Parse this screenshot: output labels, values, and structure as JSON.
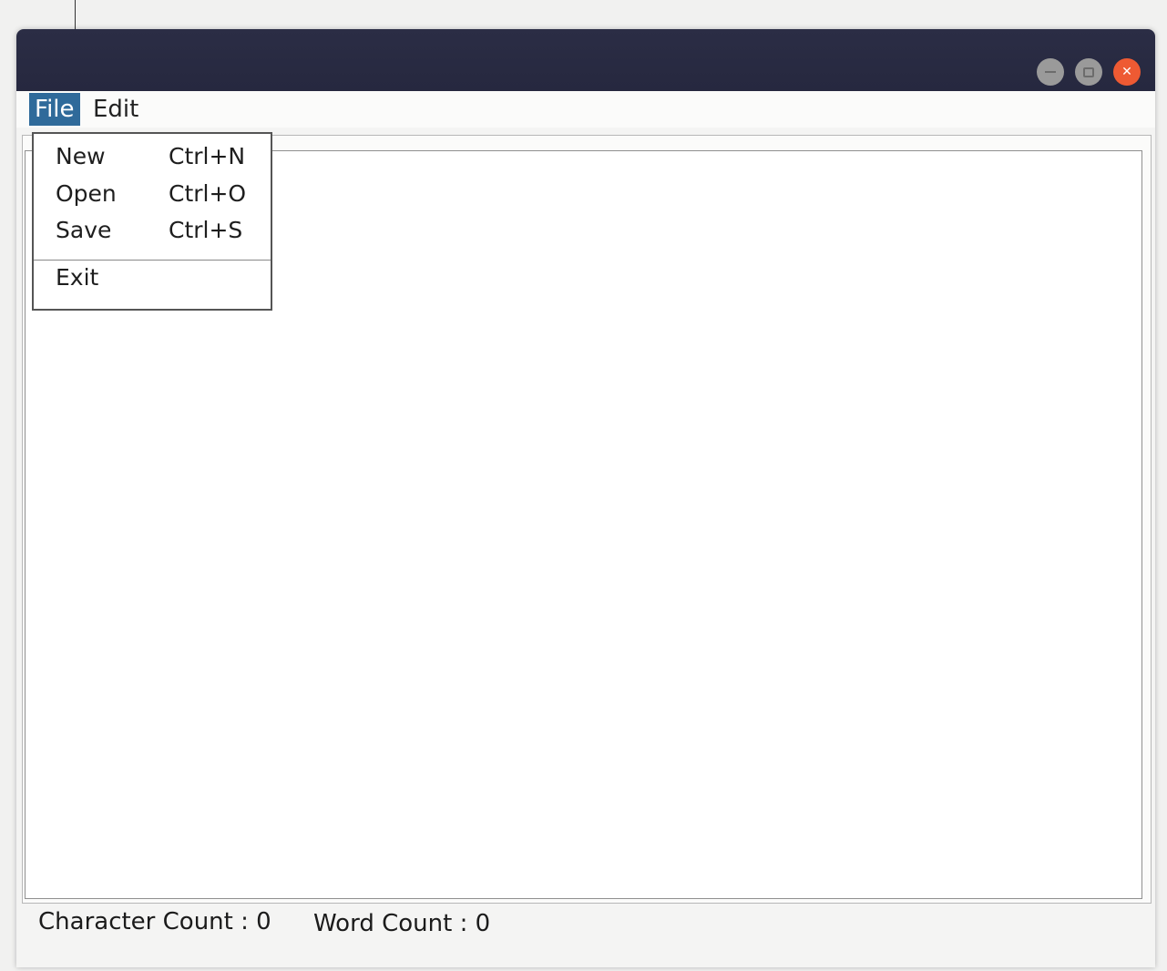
{
  "menubar": {
    "file_label": "File",
    "edit_label": "Edit"
  },
  "file_menu": {
    "items": [
      {
        "label": "New",
        "accelerator": "Ctrl+N"
      },
      {
        "label": "Open",
        "accelerator": "Ctrl+O"
      },
      {
        "label": "Save",
        "accelerator": "Ctrl+S"
      }
    ],
    "exit_label": "Exit"
  },
  "status": {
    "char_label": "Character Count :",
    "char_value": "0",
    "word_label": "Word Count :",
    "word_value": "0"
  },
  "window_controls": {
    "minimize_icon": "minimize-icon",
    "maximize_icon": "maximize-icon",
    "close_icon": "close-icon",
    "close_color": "#ee5a33"
  },
  "colors": {
    "titlebar": "#2b2d45",
    "menu_highlight": "#2f6a9a"
  }
}
